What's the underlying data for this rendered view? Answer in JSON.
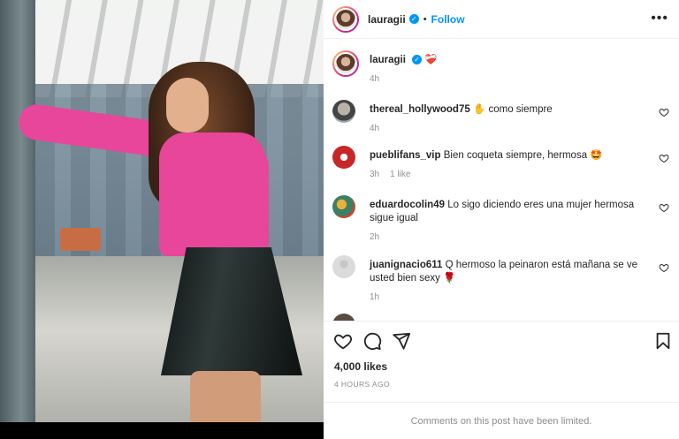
{
  "post": {
    "username": "lauragii",
    "follow_label": "Follow",
    "separator": "•",
    "more_label": "•••"
  },
  "caption": {
    "username": "lauragii",
    "emoji": "❤️‍🩹",
    "time": "4h"
  },
  "comments": [
    {
      "username": "thereal_hollywood75",
      "text": "✋ como siempre",
      "time": "4h",
      "likes": ""
    },
    {
      "username": "pueblifans_vip",
      "text": "Bien coqueta siempre, hermosa 🤩",
      "time": "3h",
      "likes": "1 like"
    },
    {
      "username": "eduardocolin49",
      "text": "Lo sigo diciendo eres una mujer hermosa sigue igual",
      "time": "2h",
      "likes": ""
    },
    {
      "username": "juanignacio611",
      "text": "Q hermoso la peinaron está mañana se ve usted bien sexy 🌹",
      "time": "1h",
      "likes": ""
    }
  ],
  "engagement": {
    "likes": "4,000 likes",
    "posted": "4 HOURS AGO"
  },
  "footer": {
    "notice": "Comments on this post have been limited."
  },
  "colors": {
    "accent": "#0095f6",
    "secondary_text": "#8e8e8e",
    "sweater": "#e8469a"
  },
  "icons": [
    "more-icon",
    "verified-icon",
    "heart-icon",
    "comment-icon",
    "share-icon",
    "bookmark-icon"
  ]
}
